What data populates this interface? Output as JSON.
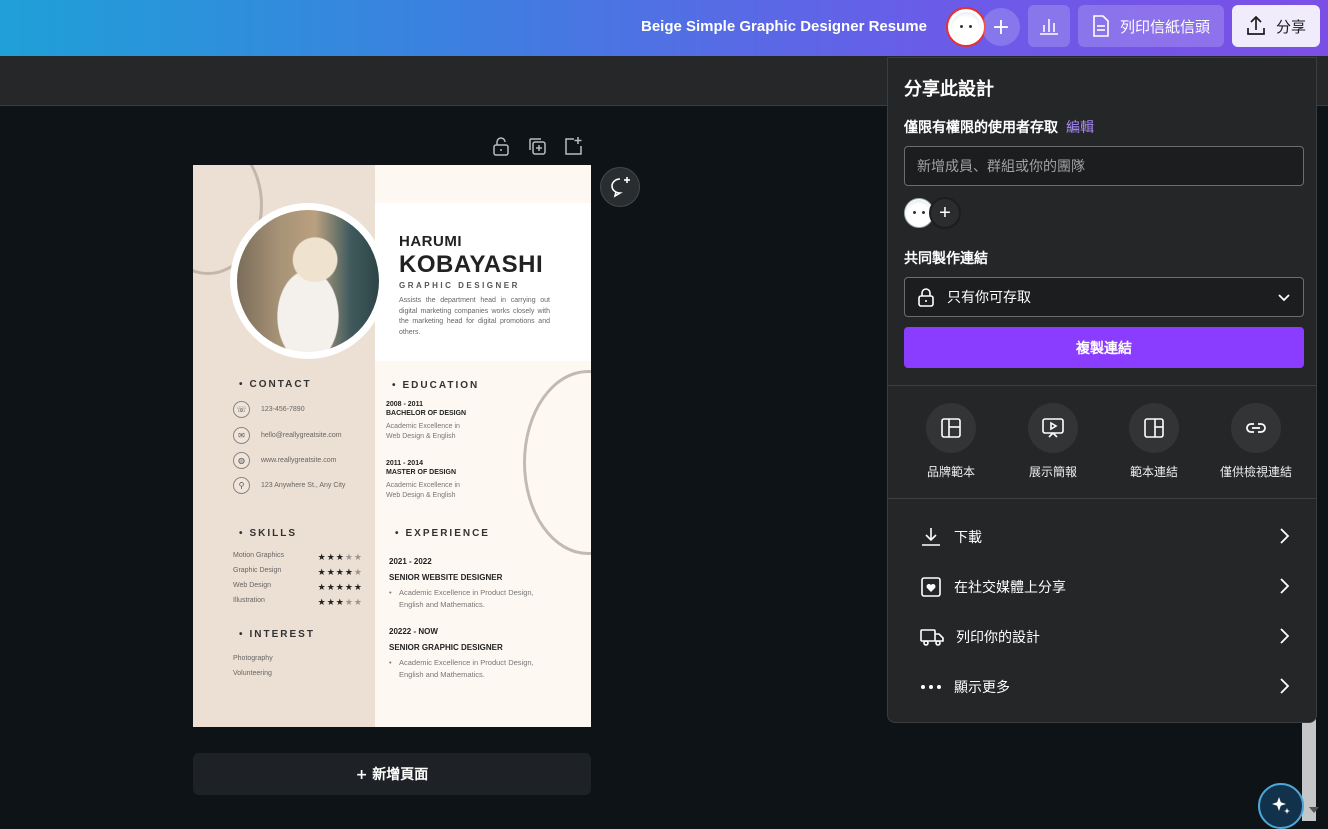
{
  "topbar": {
    "doc_title": "Beige Simple Graphic Designer Resume",
    "print_label": "列印信紙信頭",
    "share_label": "分享"
  },
  "resume": {
    "first_name": "HARUMI",
    "last_name": "KOBAYASHI",
    "role": "GRAPHIC DESIGNER",
    "summary": "Assists the department head in carrying out digital marketing companies works closely with the marketing head for digital promotions and others.",
    "contact_heading": "CONTACT",
    "contact": [
      {
        "icon": "phone-icon",
        "text": "123-456-7890"
      },
      {
        "icon": "mail-icon",
        "text": "hello@reallygreatsite.com"
      },
      {
        "icon": "globe-icon",
        "text": "www.reallygreatsite.com"
      },
      {
        "icon": "location-icon",
        "text": "123 Anywhere St., Any City"
      }
    ],
    "skills_heading": "SKILLS",
    "skills": [
      {
        "name": "Motion Graphics",
        "rating": 3
      },
      {
        "name": "Graphic Design",
        "rating": 4
      },
      {
        "name": "Web Design",
        "rating": 5
      },
      {
        "name": "Illustration",
        "rating": 3
      }
    ],
    "interest_heading": "INTEREST",
    "interests": [
      "Photography",
      "Volunteering"
    ],
    "education_heading": "EDUCATION",
    "education": [
      {
        "dates": "2008 - 2011",
        "title": "BACHELOR OF DESIGN",
        "desc": "Academic Excellence in Web Design & English"
      },
      {
        "dates": "2011 - 2014",
        "title": "MASTER OF DESIGN",
        "desc": "Academic Excellence in Web Design & English"
      }
    ],
    "experience_heading": "EXPERIENCE",
    "experience": [
      {
        "dates": "2021 - 2022",
        "title": "SENIOR WEBSITE DESIGNER",
        "desc": "Academic Excellence in Product Design, English and Mathematics."
      },
      {
        "dates": "20222 - NOW",
        "title": "SENIOR GRAPHIC DESIGNER",
        "desc": "Academic Excellence in Product Design, English and Mathematics."
      }
    ]
  },
  "canvas": {
    "add_page_label": "+ 新增頁面"
  },
  "share_panel": {
    "title": "分享此設計",
    "access_label": "僅限有權限的使用者存取",
    "edit_label": "編輯",
    "input_placeholder": "新增成員、群組或你的團隊",
    "collab_link_label": "共同製作連結",
    "link_access_value": "只有你可存取",
    "copy_link_label": "複製連結",
    "options": [
      {
        "icon": "brand-template-icon",
        "label": "品牌範本"
      },
      {
        "icon": "present-icon",
        "label": "展示簡報"
      },
      {
        "icon": "template-link-icon",
        "label": "範本連結"
      },
      {
        "icon": "link-icon",
        "label": "僅供檢視連結"
      }
    ],
    "actions": [
      {
        "icon": "download-icon",
        "label": "下載"
      },
      {
        "icon": "social-share-icon",
        "label": "在社交媒體上分享"
      },
      {
        "icon": "print-truck-icon",
        "label": "列印你的設計"
      },
      {
        "icon": "more-icon",
        "label": "顯示更多"
      }
    ]
  },
  "colors": {
    "accent": "#8b3dff",
    "edit_link": "#a98cf7",
    "resume_beige": "#ecdfd3"
  }
}
